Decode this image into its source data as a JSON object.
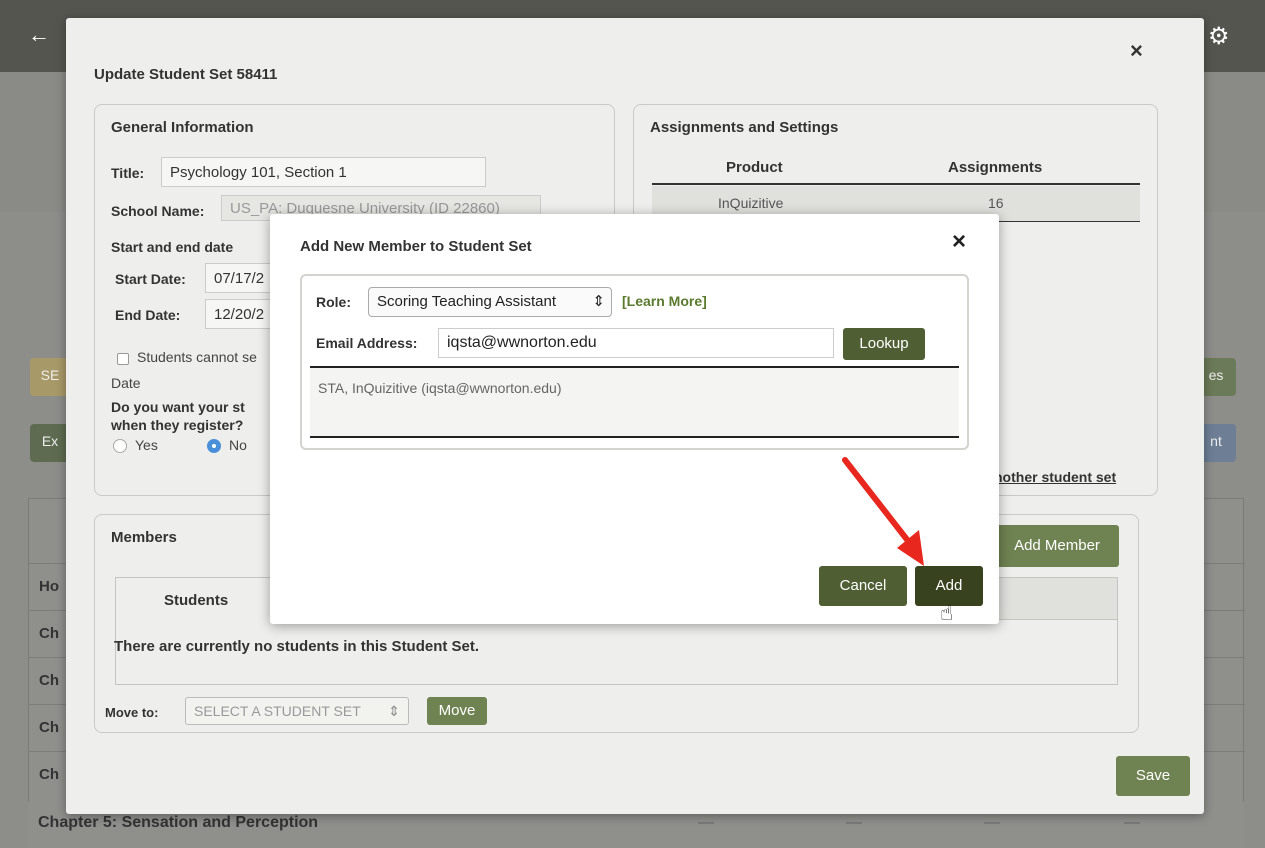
{
  "background": {
    "back_icon": "←",
    "settings_icon": "⚙",
    "left_tags": [
      "SE",
      "Ex"
    ],
    "right_tags": [
      "es",
      "nt"
    ],
    "chapter_rows": [
      "Ho",
      "Ch",
      "Ch",
      "Ch",
      "Ch"
    ],
    "last_row": {
      "label": "Chapter 5: Sensation and Perception",
      "dashes": [
        "—",
        "—",
        "—",
        "—"
      ]
    }
  },
  "outer_modal": {
    "title": "Update Student Set 58411",
    "close_icon": "×",
    "general_information": {
      "heading": "General Information",
      "title_label": "Title:",
      "title_value": "Psychology 101, Section 1",
      "school_label": "School Name:",
      "school_value": "US_PA: Duquesne University (ID 22860)",
      "dates_heading": "Start and end date",
      "start_label": "Start Date:",
      "start_value": "07/17/2",
      "end_label": "End Date:",
      "end_value": "12/20/2",
      "checkbox_label": "Students cannot se",
      "checkbox_label_line2": "Date",
      "question_line1": "Do you want your st",
      "question_line2": "when they register?",
      "radio_yes": "Yes",
      "radio_no": "No"
    },
    "assignments": {
      "heading": "Assignments and Settings",
      "columns": [
        "Product",
        "Assignments"
      ],
      "rows": [
        {
          "product": "InQuizitive",
          "assignments": "16"
        }
      ],
      "link_text": "nother student set"
    },
    "members": {
      "heading": "Members",
      "add_member_label": "Add Member",
      "tab_students": "Students",
      "empty_message": "There are currently no students in this Student Set.",
      "move_to_label": "Move to:",
      "move_select_value": "SELECT A STUDENT SET",
      "move_button": "Move"
    },
    "save_button": "Save"
  },
  "dialog": {
    "title": "Add New Member to Student Set",
    "close_icon": "×",
    "role_label": "Role:",
    "role_value": "Scoring Teaching Assistant",
    "learn_more": "[Learn More]",
    "email_label": "Email Address:",
    "email_value": "iqsta@wwnorton.edu",
    "lookup_button": "Lookup",
    "result_text": "STA,  InQuizitive  (iqsta@wwnorton.edu)",
    "cancel_button": "Cancel",
    "add_button": "Add"
  },
  "colors": {
    "button_dark_green": "#4f5f33",
    "add_button": "#38421f",
    "learn_more": "#5a7a2e",
    "arrow": "#e8281e",
    "radio_selected": "#4a90d9"
  }
}
